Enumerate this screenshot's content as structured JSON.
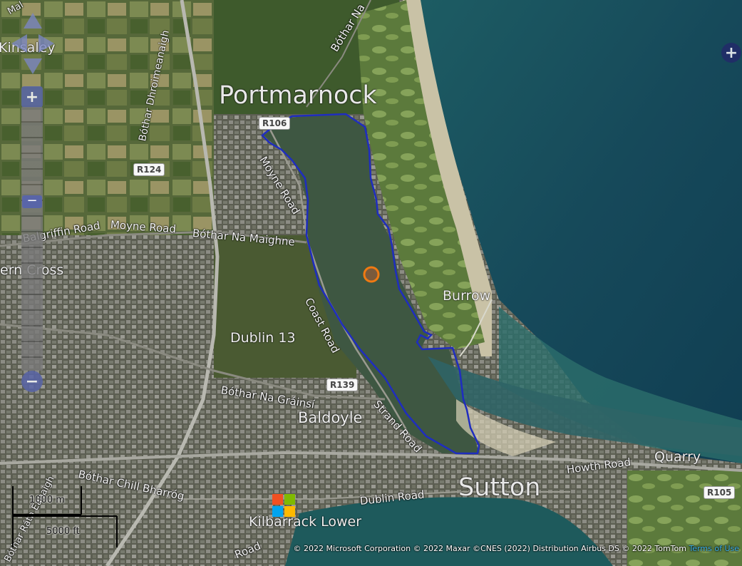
{
  "map": {
    "place_labels": {
      "portmarnock": "Portmarnock",
      "kinsaley": "Kinsaley",
      "ern_cross": "ern Cross",
      "burrow": "Burrow",
      "dublin13": "Dublin 13",
      "baldoyle": "Baldoyle",
      "sutton": "Sutton",
      "quarry": "Quarry",
      "kilbarrack": "Kilbarrack Lower"
    },
    "road_labels": {
      "bothar_na_top": "Bóthar Na",
      "bothar_dhroimeanaigh": "Bóthar Dhroimeanaigh",
      "balgriffin_road": "Balgriffin Road",
      "moyne_road_west": "Moyne Road",
      "bothar_na_maighne": "Bóthar Na Maighne",
      "moyne_road": "Moyne Road",
      "coast_road": "Coast Road",
      "bothar_na_grainsi": "Bóthar Na Gráinsí",
      "strand_road": "Strand Road",
      "bothar_chill_bharrog": "Bóthar Chill Bharróg",
      "howth_road": "Howth Road",
      "dublin_road": "Dublin Road",
      "bothar_rath_enaigh": "Bóthar Ráth Éanaigh",
      "road_bottom": "Road",
      "mal": "Mal"
    },
    "road_shields": [
      "R106",
      "R124",
      "R139",
      "R105"
    ],
    "colors": {
      "boundary": "#1f2dbf",
      "marker": "#f07a12",
      "control": "#5965a8",
      "link": "#3bb3e8"
    },
    "controls": {
      "zoom_in_label": "+",
      "zoom_out_label": "−",
      "thumb_label": "−",
      "expand_label": "+"
    },
    "scale": {
      "metric": "1000 m",
      "imperial": "5000 ft"
    },
    "attribution": {
      "text": "© 2022 Microsoft Corporation © 2022 Maxar ©CNES (2022) Distribution Airbus DS © 2022 TomTom",
      "link_text": "Terms of Use"
    },
    "icons": {
      "pan_up": "triangle-up-icon",
      "pan_left": "triangle-left-icon",
      "pan_right": "triangle-right-icon",
      "pan_down": "triangle-down-icon",
      "logo": "microsoft-logo-icon",
      "location_marker": "circle-marker-icon"
    }
  }
}
